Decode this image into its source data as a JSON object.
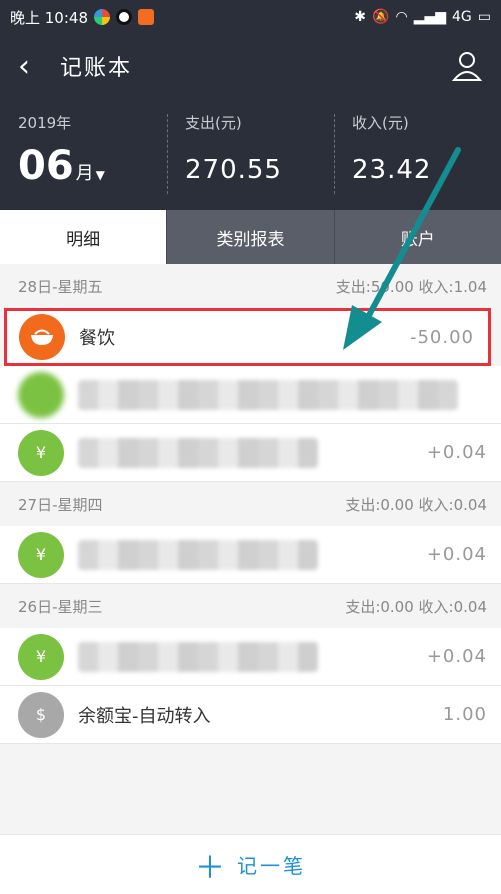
{
  "status_bar": {
    "time": "晚上 10:48",
    "network": "4G"
  },
  "header": {
    "title": "记账本",
    "year": "2019年",
    "month_num": "06",
    "month_unit": "月",
    "expense_label": "支出(元)",
    "expense_value": "270.55",
    "income_label": "收入(元)",
    "income_value": "23.42"
  },
  "tabs": [
    "明细",
    "类别报表",
    "账户"
  ],
  "days": [
    {
      "date": "28日-星期五",
      "summary": "支出:50.00 收入:1.04",
      "rows": [
        {
          "name": "餐饮",
          "amount": "-50.00",
          "icon": "bowl-icon",
          "color": "#f26a1b"
        },
        {
          "name": "",
          "amount": "",
          "icon": "",
          "color": "#7cc242"
        },
        {
          "name": "",
          "amount": "+0.04",
          "icon": "money-bag-icon",
          "color": "#7cc242"
        }
      ]
    },
    {
      "date": "27日-星期四",
      "summary": "支出:0.00 收入:0.04",
      "rows": [
        {
          "name": "",
          "amount": "+0.04",
          "icon": "money-bag-icon",
          "color": "#7cc242"
        }
      ]
    },
    {
      "date": "26日-星期三",
      "summary": "支出:0.00 收入:0.04",
      "rows": [
        {
          "name": "",
          "amount": "+0.04",
          "icon": "money-bag-icon",
          "color": "#7cc242"
        },
        {
          "name": "余额宝-自动转入",
          "amount": "1.00",
          "icon": "money-bag-icon",
          "color": "#a8a8a8"
        }
      ]
    }
  ],
  "bottom": {
    "add_label": "记一笔"
  }
}
